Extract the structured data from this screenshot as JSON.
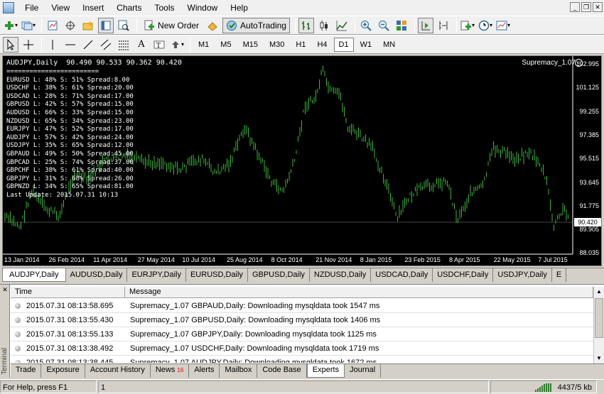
{
  "menu": [
    "File",
    "View",
    "Insert",
    "Charts",
    "Tools",
    "Window",
    "Help"
  ],
  "toolbar": {
    "new_order": "New Order",
    "autotrading": "AutoTrading"
  },
  "timeframes": [
    "M1",
    "M5",
    "M15",
    "M30",
    "H1",
    "H4",
    "D1",
    "W1",
    "MN"
  ],
  "active_timeframe": "D1",
  "chart": {
    "header": "AUDJPY,Daily  90.490 90.533 90.362 90.420",
    "ea_name": "Supremacy_1.07",
    "smile": "☺",
    "overlay_lines": [
      "========================",
      "EURUSD L: 48% S: 51% Spread:8.00",
      "USDCHF L: 38% S: 61% Spread:20.00",
      "USDCAD L: 28% S: 71% Spread:17.00",
      "GBPUSD L: 42% S: 57% Spread:15.00",
      "AUDUSD L: 66% S: 33% Spread:15.00",
      "NZDUSD L: 65% S: 34% Spread:23.00",
      "EURJPY L: 47% S: 52% Spread:17.00",
      "AUDJPY L: 57% S: 42% Spread:24.00",
      "USDJPY L: 35% S: 65% Spread:12.00",
      "GBPAUD L: 49% S: 50% Spread:45.00",
      "GBPCAD L: 25% S: 74% Spread:37.00",
      "GBPCHF L: 38% S: 61% Spread:40.00",
      "GBPJPY L: 31% S: 68% Spread:26.00",
      "GBPNZD L: 34% S: 65% Spread:81.00",
      "Last Update: 2015.07.31 10:13"
    ],
    "price_labels": [
      "102.995",
      "101.125",
      "99.255",
      "97.385",
      "95.515",
      "93.645",
      "91.775",
      "89.905",
      "88.035"
    ],
    "current_price": "90.420",
    "time_labels": [
      "13 Jan 2014",
      "26 Feb 2014",
      "11 Apr 2014",
      "27 May 2014",
      "10 Jul 2014",
      "25 Aug 2014",
      "8 Oct 2014",
      "21 Nov 2014",
      "8 Jan 2015",
      "23 Feb 2015",
      "8 Apr 2015",
      "22 May 2015",
      "7 Jul 2015"
    ],
    "bar_color": "#3cb43c",
    "background": "#000000"
  },
  "chart_tabs": [
    "AUDJPY,Daily",
    "AUDUSD,Daily",
    "EURJPY,Daily",
    "EURUSD,Daily",
    "GBPUSD,Daily",
    "NZDUSD,Daily",
    "USDCAD,Daily",
    "USDCHF,Daily",
    "USDJPY,Daily",
    "E"
  ],
  "terminal": {
    "label": "Terminal",
    "columns": [
      "Time",
      "Message"
    ],
    "rows": [
      {
        "time": "2015.07.31 08:13:58.695",
        "message": "Supremacy_1.07 GBPAUD,Daily: Downloading mysqldata took 1547 ms"
      },
      {
        "time": "2015.07.31 08:13:55.430",
        "message": "Supremacy_1.07 GBPUSD,Daily: Downloading mysqldata took 1406 ms"
      },
      {
        "time": "2015.07.31 08:13:55.133",
        "message": "Supremacy_1.07 GBPJPY,Daily: Downloading mysqldata took 1125 ms"
      },
      {
        "time": "2015.07.31 08:13:38.492",
        "message": "Supremacy_1.07 USDCHF,Daily: Downloading mysqldata took 1719 ms"
      },
      {
        "time": "2015.07.31 08:13:38.445",
        "message": "Supremacy_1.07 AUDJPY,Daily: Downloading mysqldata took 1672 ms"
      }
    ],
    "tabs": [
      {
        "label": "Trade"
      },
      {
        "label": "Exposure"
      },
      {
        "label": "Account History"
      },
      {
        "label": "News",
        "badge": "16"
      },
      {
        "label": "Alerts"
      },
      {
        "label": "Mailbox"
      },
      {
        "label": "Code Base"
      },
      {
        "label": "Experts",
        "active": true
      },
      {
        "label": "Journal"
      }
    ]
  },
  "status": {
    "help": "For Help, press F1",
    "profile": "1",
    "traffic": "4437/5 kb"
  }
}
